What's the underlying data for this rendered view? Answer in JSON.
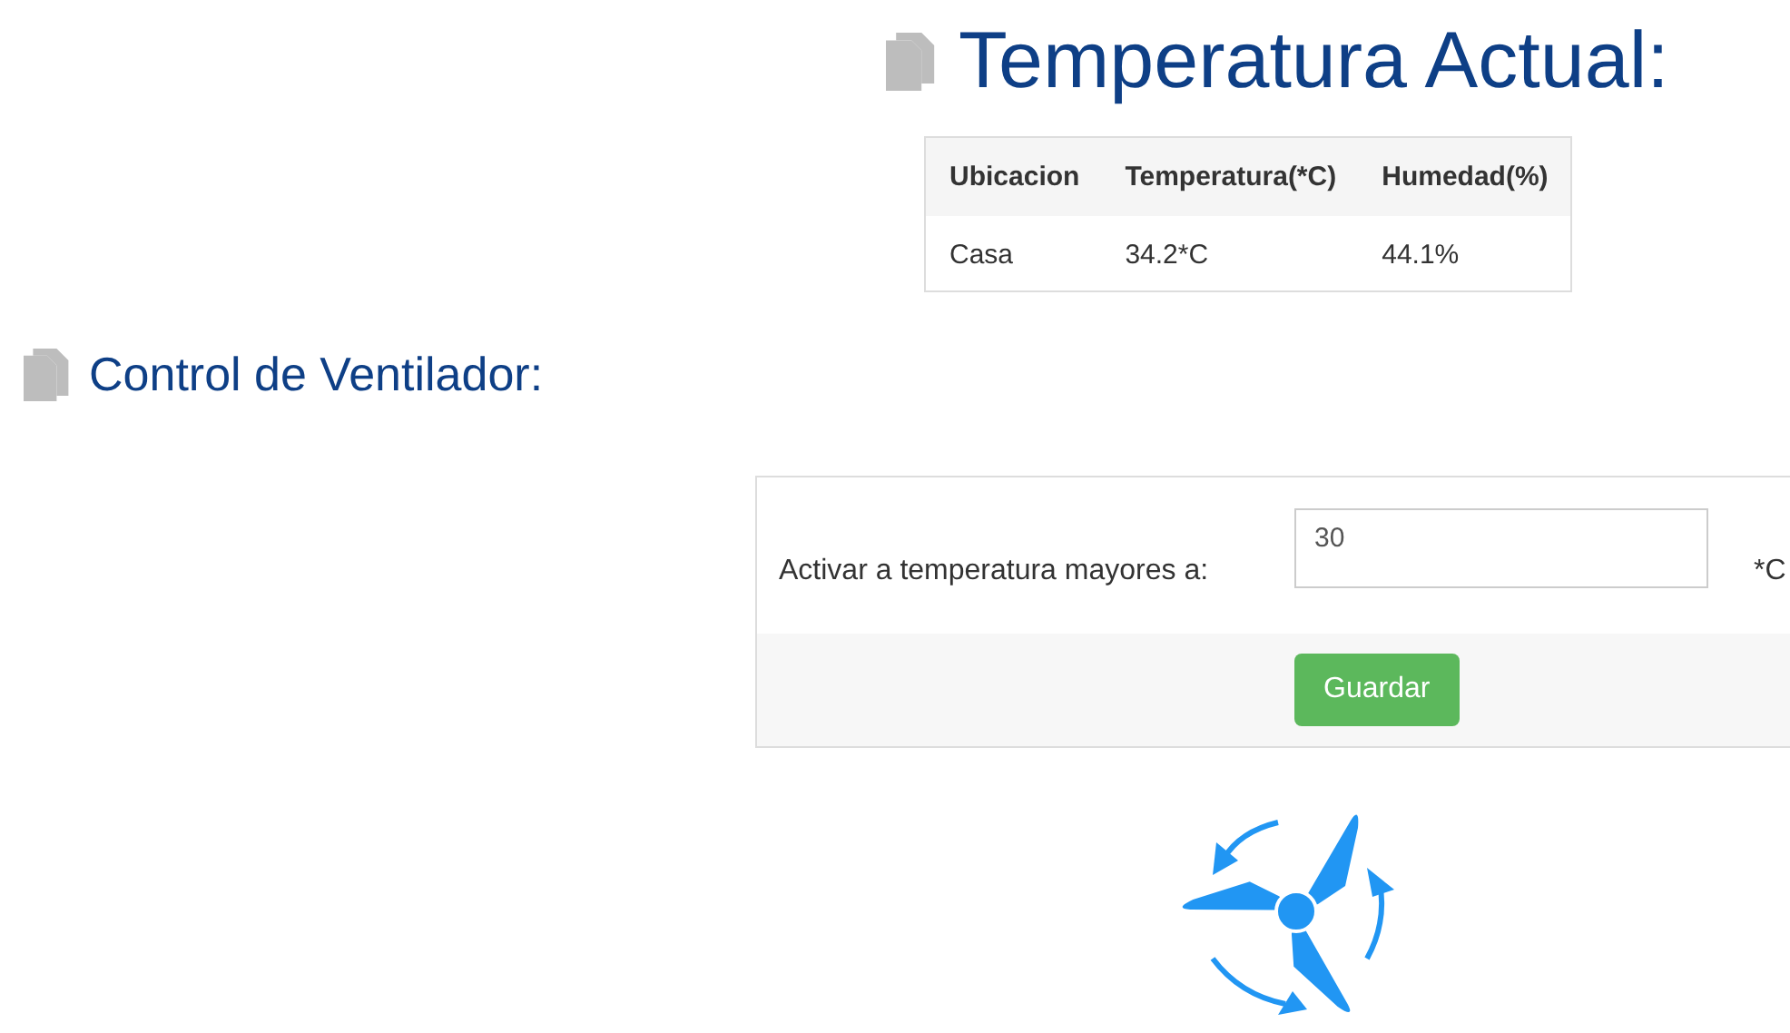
{
  "header": {
    "title": "Temperatura Actual:"
  },
  "table": {
    "columns": [
      "Ubicacion",
      "Temperatura(*C)",
      "Humedad(%)"
    ],
    "rows": [
      [
        "Casa",
        "34.2*C",
        "44.1%"
      ]
    ]
  },
  "section": {
    "title": "Control de Ventilador:"
  },
  "form": {
    "label": "Activar a temperatura mayores a:",
    "value": "30",
    "unit": "*C",
    "button": "Guardar"
  }
}
